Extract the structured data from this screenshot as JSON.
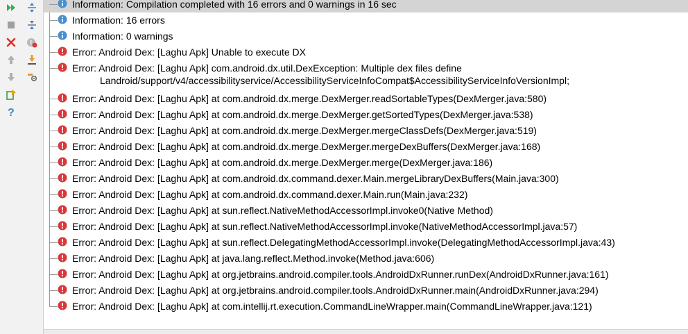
{
  "toolbar": {
    "left": [
      {
        "name": "rerun-icon",
        "color": "#2fb24c"
      },
      {
        "name": "stop-icon",
        "color": "#9a9a9a"
      },
      {
        "name": "close-icon",
        "color": "#d9322b"
      },
      {
        "name": "arrow-up-icon",
        "color": "#a8a8a8"
      },
      {
        "name": "arrow-down-icon",
        "color": "#a8a8a8"
      },
      {
        "name": "export-icon",
        "color": "#3c9b3c"
      },
      {
        "name": "help-icon",
        "color": "#3f86c9"
      }
    ],
    "right": [
      {
        "name": "expand-all-icon"
      },
      {
        "name": "collapse-all-icon"
      },
      {
        "name": "hide-warnings-icon"
      },
      {
        "name": "autoscroll-icon"
      },
      {
        "name": "settings-icon"
      }
    ]
  },
  "messages": [
    {
      "type": "info",
      "text": "Information: Compilation completed with 16 errors and 0 warnings in 16 sec"
    },
    {
      "type": "info",
      "text": "Information: 16 errors"
    },
    {
      "type": "info",
      "text": "Information: 0 warnings"
    },
    {
      "type": "error",
      "text": "Error: Android Dex: [Laghu Apk] Unable to execute DX"
    },
    {
      "type": "error",
      "text": "Error: Android Dex: [Laghu Apk] com.android.dx.util.DexException: Multiple dex files define",
      "text2": "Landroid/support/v4/accessibilityservice/AccessibilityServiceInfoCompat$AccessibilityServiceInfoVersionImpl;"
    },
    {
      "type": "error",
      "text": "Error: Android Dex: [Laghu Apk] at com.android.dx.merge.DexMerger.readSortableTypes(DexMerger.java:580)"
    },
    {
      "type": "error",
      "text": "Error: Android Dex: [Laghu Apk] at com.android.dx.merge.DexMerger.getSortedTypes(DexMerger.java:538)"
    },
    {
      "type": "error",
      "text": "Error: Android Dex: [Laghu Apk] at com.android.dx.merge.DexMerger.mergeClassDefs(DexMerger.java:519)"
    },
    {
      "type": "error",
      "text": "Error: Android Dex: [Laghu Apk] at com.android.dx.merge.DexMerger.mergeDexBuffers(DexMerger.java:168)"
    },
    {
      "type": "error",
      "text": "Error: Android Dex: [Laghu Apk] at com.android.dx.merge.DexMerger.merge(DexMerger.java:186)"
    },
    {
      "type": "error",
      "text": "Error: Android Dex: [Laghu Apk] at com.android.dx.command.dexer.Main.mergeLibraryDexBuffers(Main.java:300)"
    },
    {
      "type": "error",
      "text": "Error: Android Dex: [Laghu Apk] at com.android.dx.command.dexer.Main.run(Main.java:232)"
    },
    {
      "type": "error",
      "text": "Error: Android Dex: [Laghu Apk] at sun.reflect.NativeMethodAccessorImpl.invoke0(Native Method)"
    },
    {
      "type": "error",
      "text": "Error: Android Dex: [Laghu Apk] at sun.reflect.NativeMethodAccessorImpl.invoke(NativeMethodAccessorImpl.java:57)"
    },
    {
      "type": "error",
      "text": "Error: Android Dex: [Laghu Apk] at sun.reflect.DelegatingMethodAccessorImpl.invoke(DelegatingMethodAccessorImpl.java:43)"
    },
    {
      "type": "error",
      "text": "Error: Android Dex: [Laghu Apk] at java.lang.reflect.Method.invoke(Method.java:606)"
    },
    {
      "type": "error",
      "text": "Error: Android Dex: [Laghu Apk] at org.jetbrains.android.compiler.tools.AndroidDxRunner.runDex(AndroidDxRunner.java:161)"
    },
    {
      "type": "error",
      "text": "Error: Android Dex: [Laghu Apk] at org.jetbrains.android.compiler.tools.AndroidDxRunner.main(AndroidDxRunner.java:294)"
    },
    {
      "type": "error",
      "text": "Error: Android Dex: [Laghu Apk] at com.intellij.rt.execution.CommandLineWrapper.main(CommandLineWrapper.java:121)"
    }
  ],
  "colors": {
    "info": "#4a8fd0",
    "error": "#d8393a",
    "selected_row": "#d4d4d4"
  }
}
